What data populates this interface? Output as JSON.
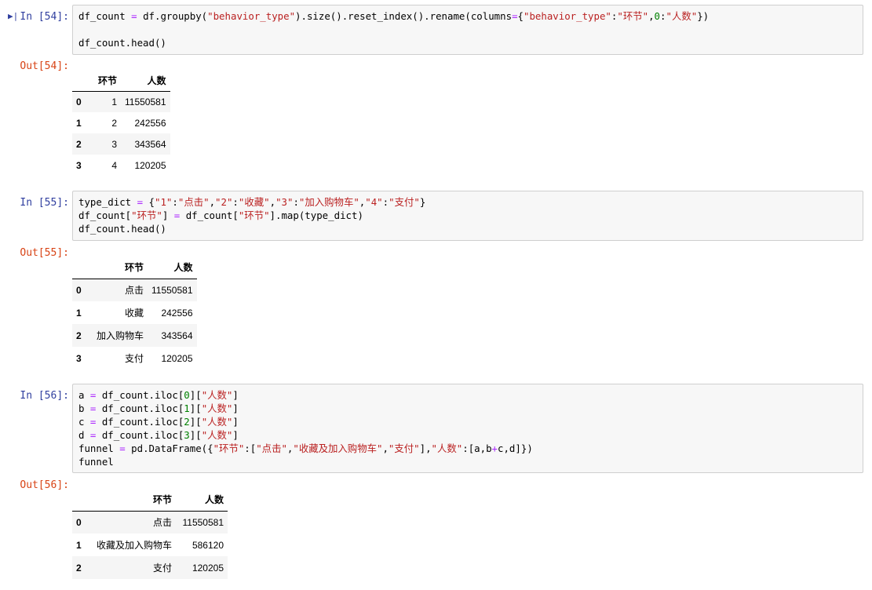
{
  "cells": [
    {
      "in_prompt": "In  [54]:",
      "out_prompt": "Out[54]:",
      "code_lines": [
        "df_count = df.groupby(\"behavior_type\").size().reset_index().rename(columns={\"behavior_type\":\"环节\",0:\"人数\"})",
        "",
        "df_count.head()"
      ],
      "table": {
        "columns": [
          "",
          "环节",
          "人数"
        ],
        "rows": [
          [
            "0",
            "1",
            "11550581"
          ],
          [
            "1",
            "2",
            "242556"
          ],
          [
            "2",
            "3",
            "343564"
          ],
          [
            "3",
            "4",
            "120205"
          ]
        ]
      }
    },
    {
      "in_prompt": "In  [55]:",
      "out_prompt": "Out[55]:",
      "code_lines": [
        "type_dict = {\"1\":\"点击\",\"2\":\"收藏\",\"3\":\"加入购物车\",\"4\":\"支付\"}",
        "df_count[\"环节\"] = df_count[\"环节\"].map(type_dict)",
        "df_count.head()"
      ],
      "table": {
        "columns": [
          "",
          "环节",
          "人数"
        ],
        "rows": [
          [
            "0",
            "点击",
            "11550581"
          ],
          [
            "1",
            "收藏",
            "242556"
          ],
          [
            "2",
            "加入购物车",
            "343564"
          ],
          [
            "3",
            "支付",
            "120205"
          ]
        ]
      }
    },
    {
      "in_prompt": "In  [56]:",
      "out_prompt": "Out[56]:",
      "code_lines": [
        "a = df_count.iloc[0][\"人数\"]",
        "b = df_count.iloc[1][\"人数\"]",
        "c = df_count.iloc[2][\"人数\"]",
        "d = df_count.iloc[3][\"人数\"]",
        "funnel = pd.DataFrame({\"环节\":[\"点击\",\"收藏及加入购物车\",\"支付\"],\"人数\":[a,b+c,d]})",
        "funnel"
      ],
      "table": {
        "columns": [
          "",
          "环节",
          "人数"
        ],
        "rows": [
          [
            "0",
            "点击",
            "11550581"
          ],
          [
            "1",
            "收藏及加入购物车",
            "586120"
          ],
          [
            "2",
            "支付",
            "120205"
          ]
        ]
      }
    }
  ],
  "active_cell_marker_icon": "run-arrow-icon"
}
